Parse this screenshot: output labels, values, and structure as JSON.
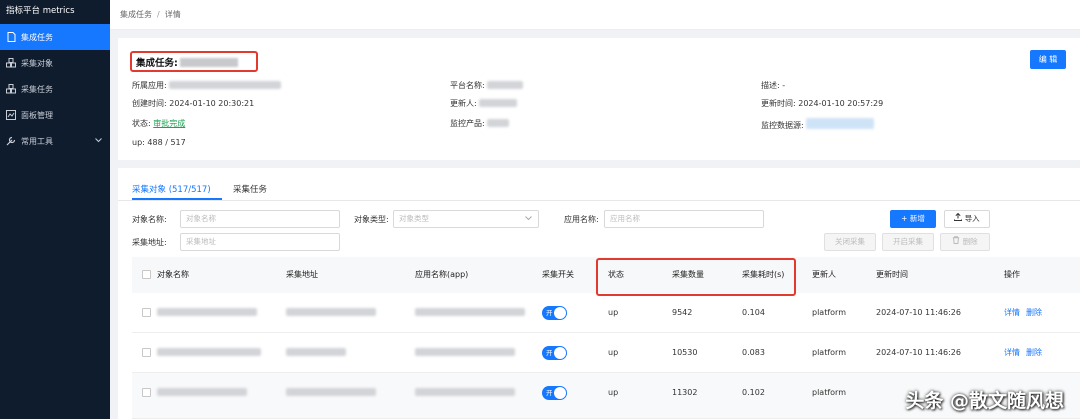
{
  "app": {
    "title": "指标平台 metrics"
  },
  "sidebar": {
    "items": [
      {
        "label": "集成任务",
        "icon": "file-icon",
        "active": true
      },
      {
        "label": "采集对象",
        "icon": "cluster-icon"
      },
      {
        "label": "采集任务",
        "icon": "cluster-icon"
      },
      {
        "label": "面板管理",
        "icon": "dashboard-icon"
      },
      {
        "label": "常用工具",
        "icon": "wrench-icon",
        "has_submenu": true
      }
    ]
  },
  "breadcrumb": {
    "root": "集成任务",
    "separator": "/",
    "current": "详情"
  },
  "task": {
    "title_prefix": "集成任务:",
    "edit_label": "编 辑",
    "fields": {
      "app_label": "所属应用:",
      "platform_label": "平台名称:",
      "desc_label": "描述:",
      "desc_value": "-",
      "created_label": "创建时间:",
      "created_value": "2024-01-10 20:30:21",
      "updater_label": "更新人:",
      "updated_label": "更新时间:",
      "updated_value": "2024-01-10 20:57:29",
      "status_label": "状态:",
      "status_value": "审批完成",
      "product_label": "监控产品:",
      "datasource_label": "监控数据源:",
      "up_label": "up:",
      "up_value": "488 / 517"
    }
  },
  "tabs": [
    {
      "label": "采集对象 (517/517)",
      "active": true
    },
    {
      "label": "采集任务",
      "active": false
    }
  ],
  "filters": {
    "object_name_label": "对象名称:",
    "object_name_placeholder": "对象名称",
    "object_type_label": "对象类型:",
    "object_type_placeholder": "对象类型",
    "app_name_label": "应用名称:",
    "app_name_placeholder": "应用名称",
    "address_label": "采集地址:",
    "address_placeholder": "采集地址"
  },
  "actions": {
    "add": "+ 新增",
    "import": "导入",
    "close_collect": "关闭采集",
    "open_collect": "开启采集",
    "delete": "删除"
  },
  "table": {
    "columns": [
      "对象名称",
      "采集地址",
      "应用名称(app)",
      "采集开关",
      "状态",
      "采集数量",
      "采集耗时(s)",
      "更新人",
      "更新时间",
      "操作"
    ],
    "rows": [
      {
        "status": "up",
        "count": "9542",
        "duration": "0.104",
        "updater": "platform",
        "updated": "2024-07-10 11:46:26",
        "toggle": "开",
        "detail": "详情",
        "remove": "删除"
      },
      {
        "status": "up",
        "count": "10530",
        "duration": "0.083",
        "updater": "platform",
        "updated": "2024-07-10 11:46:26",
        "toggle": "开",
        "detail": "详情",
        "remove": "删除"
      },
      {
        "status": "up",
        "count": "11302",
        "duration": "0.102",
        "updater": "platform",
        "updated": "",
        "toggle": "开",
        "detail": "",
        "remove": ""
      }
    ]
  },
  "watermark": "头条 @散文随风想",
  "colors": {
    "primary": "#1677ff",
    "sidebar": "#0f1c2e",
    "highlight": "#e23a2e",
    "success": "#1aa251"
  }
}
